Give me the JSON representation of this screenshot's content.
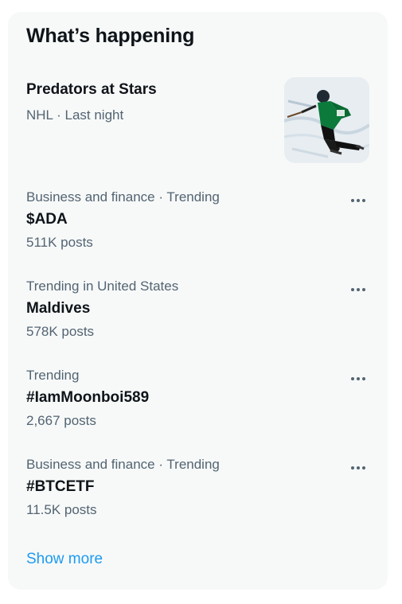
{
  "header": {
    "title": "What’s happening"
  },
  "featured": {
    "name": "Predators at Stars",
    "meta": "NHL · Last night",
    "image_icon": "hockey-player-photo"
  },
  "trends": [
    {
      "context": "Business and finance · Trending",
      "name": "$ADA",
      "count": "511K posts"
    },
    {
      "context": "Trending in United States",
      "name": "Maldives",
      "count": "578K posts"
    },
    {
      "context": "Trending",
      "name": "#IamMoonboi589",
      "count": "2,667 posts"
    },
    {
      "context": "Business and finance · Trending",
      "name": "#BTCETF",
      "count": "11.5K posts"
    }
  ],
  "footer": {
    "show_more": "Show more"
  },
  "colors": {
    "panel_bg": "#f7f9f9",
    "primary_text": "#0f1419",
    "secondary_text": "#536471",
    "link": "#1d9bf0"
  }
}
